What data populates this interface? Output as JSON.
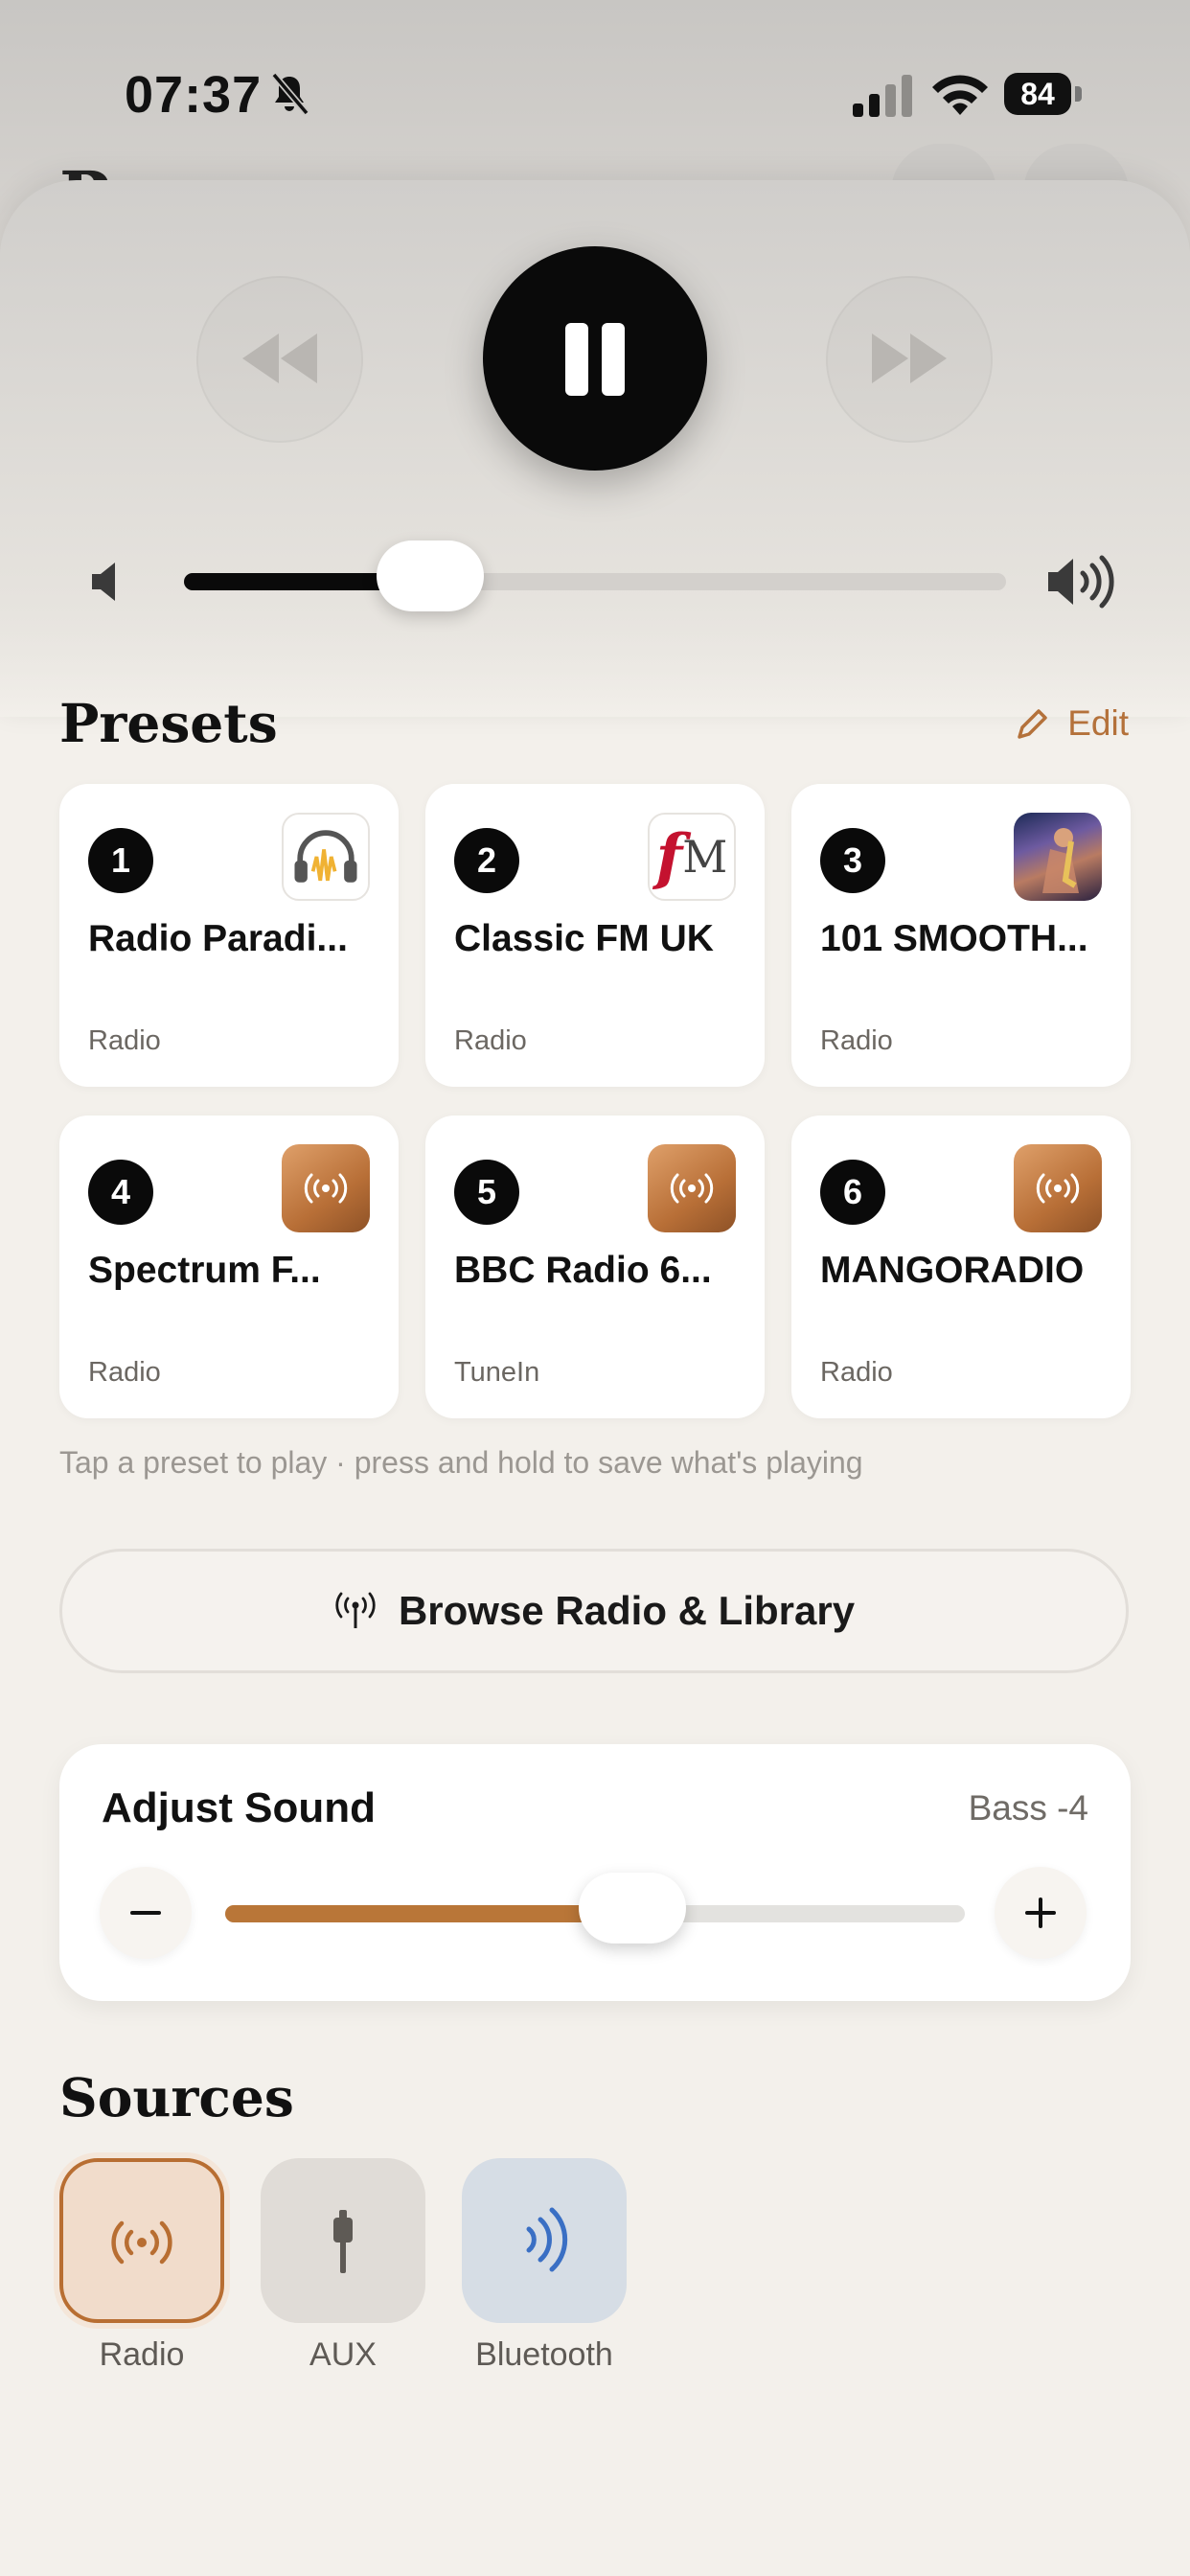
{
  "status_bar": {
    "time": "07:37",
    "battery": "84"
  },
  "player": {
    "volume": 0.3
  },
  "presets": {
    "title": "Presets",
    "edit_label": "Edit",
    "items": [
      {
        "number": "1",
        "name": "Radio Paradi...",
        "source": "Radio",
        "art": "headphones-logo"
      },
      {
        "number": "2",
        "name": "Classic FM UK",
        "source": "Radio",
        "art": "classic-fm-logo"
      },
      {
        "number": "3",
        "name": "101 SMOOTH...",
        "source": "Radio",
        "art": "saxophone-photo"
      },
      {
        "number": "4",
        "name": "Spectrum F...",
        "source": "Radio",
        "art": "radio-waves-icon"
      },
      {
        "number": "5",
        "name": "BBC Radio 6...",
        "source": "TuneIn",
        "art": "radio-waves-icon"
      },
      {
        "number": "6",
        "name": "MANGORADIO",
        "source": "Radio",
        "art": "radio-waves-icon"
      }
    ],
    "hint": "Tap a preset to play · press and hold to save what's playing"
  },
  "browse": {
    "label": "Browse Radio & Library"
  },
  "adjust_sound": {
    "title": "Adjust Sound",
    "value_label": "Bass -4",
    "level": 0.55
  },
  "sources": {
    "title": "Sources",
    "items": [
      {
        "label": "Radio",
        "selected": true
      },
      {
        "label": "AUX",
        "selected": false
      },
      {
        "label": "Bluetooth",
        "selected": false
      }
    ]
  },
  "colors": {
    "accent": "#b97638",
    "background": "#f3f0eb",
    "bluetooth": "#3a6fc4"
  }
}
